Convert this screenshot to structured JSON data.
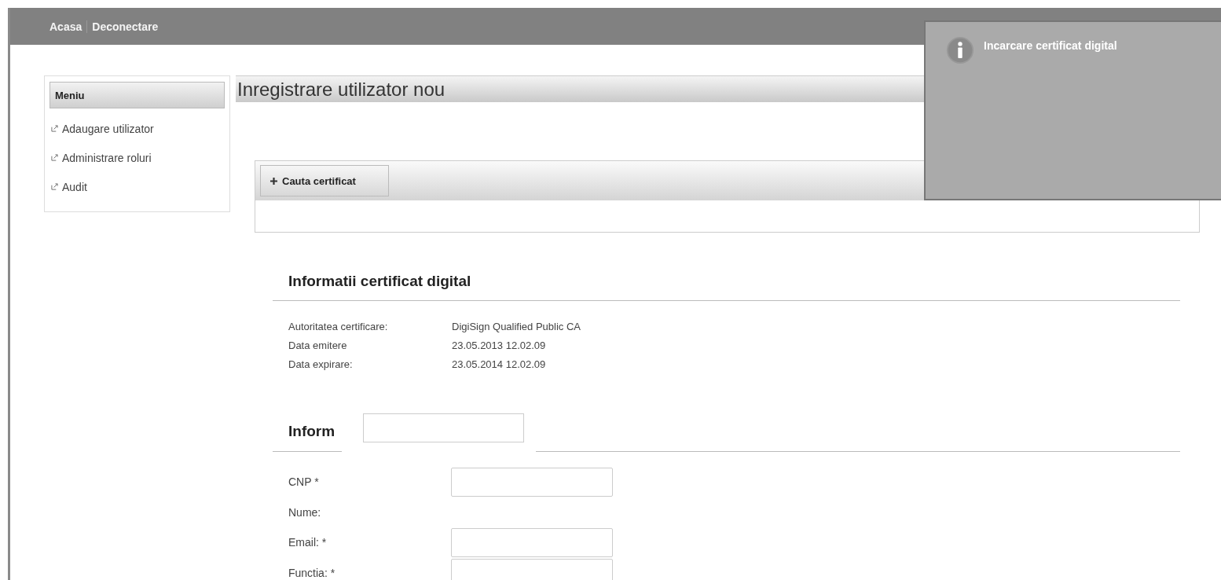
{
  "top_nav": [
    {
      "label": "Acasa"
    },
    {
      "label": "Deconectare"
    }
  ],
  "notification": {
    "title": "Incarcare certificat digital"
  },
  "sidebar": {
    "title": "Meniu",
    "items": [
      {
        "label": "Adaugare utilizator"
      },
      {
        "label": "Administrare roluri"
      },
      {
        "label": "Audit"
      }
    ]
  },
  "page_title": "Inregistrare utilizator nou",
  "certificate_panel": {
    "button": "Cauta certificat"
  },
  "certificate_info": {
    "title": "Informatii certificat digital",
    "rows": [
      {
        "label": "Autoritatea certificare:",
        "value": "DigiSign Qualified Public CA"
      },
      {
        "label": "Data emitere",
        "value": "23.05.2013 12.02.09"
      },
      {
        "label": "Data expirare:",
        "value": "23.05.2014 12.02.09"
      }
    ]
  },
  "user_info": {
    "title": "Inform",
    "fields": [
      {
        "label": "CNP *",
        "kind": "input"
      },
      {
        "label": "Nume:",
        "kind": "text"
      },
      {
        "label": "Email: *",
        "kind": "input"
      },
      {
        "label": "Functia: *",
        "kind": "input"
      }
    ]
  }
}
